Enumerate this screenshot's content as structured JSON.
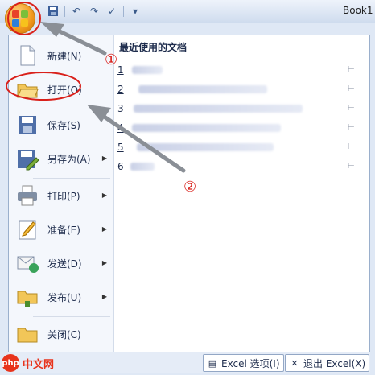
{
  "title_bar": {
    "workbook_title": "Book1",
    "qat_icons": [
      "save-icon",
      "undo-icon",
      "redo-icon",
      "check-icon"
    ]
  },
  "office_button": {
    "icon": "office-logo-icon"
  },
  "menu": {
    "items": [
      {
        "label": "新建(N)",
        "icon": "new-document-icon",
        "has_submenu": false
      },
      {
        "label": "打开(O)",
        "icon": "open-folder-icon",
        "has_submenu": false
      },
      {
        "label": "保存(S)",
        "icon": "save-floppy-icon",
        "has_submenu": false
      },
      {
        "label": "另存为(A)",
        "icon": "save-as-icon",
        "has_submenu": true
      },
      {
        "label": "打印(P)",
        "icon": "print-icon",
        "has_submenu": true
      },
      {
        "label": "准备(E)",
        "icon": "prepare-icon",
        "has_submenu": true
      },
      {
        "label": "发送(D)",
        "icon": "send-icon",
        "has_submenu": true
      },
      {
        "label": "发布(U)",
        "icon": "publish-icon",
        "has_submenu": true
      },
      {
        "label": "关闭(C)",
        "icon": "close-folder-icon",
        "has_submenu": false
      }
    ],
    "recent": {
      "heading": "最近使用的文档",
      "items": [
        {
          "number": "1",
          "name": ""
        },
        {
          "number": "2",
          "name": ""
        },
        {
          "number": "3",
          "name": ""
        },
        {
          "number": "4",
          "name": ""
        },
        {
          "number": "5",
          "name": ""
        },
        {
          "number": "6",
          "name": ""
        }
      ]
    },
    "footer": {
      "options_label": "Excel 选项(I)",
      "exit_label": "退出 Excel(X)"
    }
  },
  "annotations": {
    "marker1": "①",
    "marker2": "②",
    "color": "#d9201a"
  },
  "watermark": {
    "logo": "php",
    "text": "中文网"
  }
}
